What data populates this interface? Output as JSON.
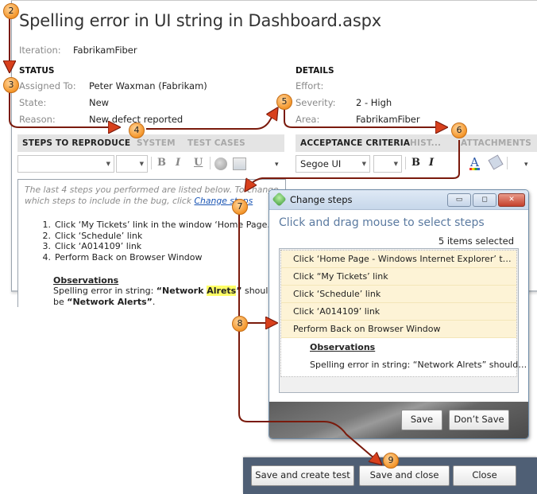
{
  "work_item": {
    "title": "Spelling error in UI string in Dashboard.aspx",
    "iteration_label": "Iteration:",
    "iteration_value": "FabrikamFiber"
  },
  "status": {
    "heading": "STATUS",
    "fields": [
      {
        "label": "Assigned To:",
        "value": "Peter Waxman (Fabrikam)"
      },
      {
        "label": "State:",
        "value": "New"
      },
      {
        "label": "Reason:",
        "value": "New defect reported"
      }
    ]
  },
  "details": {
    "heading": "DETAILS",
    "fields": [
      {
        "label": "Effort:",
        "value": ""
      },
      {
        "label": "Severity:",
        "value": "2 - High"
      },
      {
        "label": "Area:",
        "value": "FabrikamFiber"
      }
    ]
  },
  "left_tabs": {
    "items": [
      "STEPS TO REPRODUCE",
      "SYSTEM",
      "TEST CASES"
    ],
    "active": "STEPS TO REPRODUCE"
  },
  "right_tabs": {
    "items": [
      "ACCEPTANCE CRITERIA",
      "HIST...",
      "ATTACHMENTS"
    ],
    "active": "ACCEPTANCE CRITERIA"
  },
  "left_toolbar": {
    "font_value": "",
    "size_value": "",
    "buttons": [
      "B",
      "I",
      "U"
    ]
  },
  "right_toolbar": {
    "font_value": "Segoe UI",
    "size_value": "",
    "buttons": [
      "B",
      "I"
    ]
  },
  "steps_editor": {
    "hint_text": "The last 4 steps you performed are listed below. To change which steps to include in the bug, click ",
    "hint_link": "Change steps",
    "steps": [
      {
        "n": "1.",
        "text": "Click ‘My Tickets’ link in the window ‘Home Page…"
      },
      {
        "n": "2.",
        "text": "Click ‘Schedule’ link"
      },
      {
        "n": "3.",
        "text": "Click ‘A014109’ link"
      },
      {
        "n": "4.",
        "text": "Perform Back on Browser Window"
      }
    ],
    "observations_heading": "Observations",
    "observation_prefix": "Spelling error in string: ",
    "observation_bold1_a": "“Network ",
    "observation_highlight": "Alrets",
    "observation_bold1_b": "”",
    "observation_middle": " should be ",
    "observation_bold2": "“Network Alerts”",
    "observation_suffix": "."
  },
  "change_steps_dialog": {
    "title": "Change steps",
    "heading": "Click and drag mouse to select steps",
    "selection_count": "5 items selected",
    "items": [
      {
        "text": "Click ‘Home Page - Windows Internet Explorer’ t…",
        "selected": true
      },
      {
        "text": "Click “My Tickets’ link",
        "selected": true
      },
      {
        "text": "Click ‘Schedule’ link",
        "selected": true
      },
      {
        "text": "Click ‘A014109’ link",
        "selected": true
      },
      {
        "text": "Perform Back on Browser Window",
        "selected": true
      },
      {
        "text": "Observations",
        "selected": false,
        "style": "heading"
      },
      {
        "text": "Spelling error in string: “Network Alrets” should…",
        "selected": false
      }
    ],
    "save_label": "Save",
    "dont_save_label": "Don’t Save",
    "window_buttons": {
      "minimize": "▭",
      "maximize": "◻",
      "close": "✕"
    }
  },
  "bottom_bar": {
    "save_create_test": "Save and create test",
    "save_close": "Save and close",
    "close": "Close"
  },
  "callouts": [
    "2",
    "3",
    "4",
    "5",
    "6",
    "7",
    "8",
    "9"
  ],
  "colors": {
    "arrow": "#7a1a0c",
    "callout": "#f4962a",
    "link": "#1a55b4",
    "highlight": "#ffff66",
    "selected_row": "#fdf3d6",
    "bottom_bar": "#4f5f75"
  }
}
